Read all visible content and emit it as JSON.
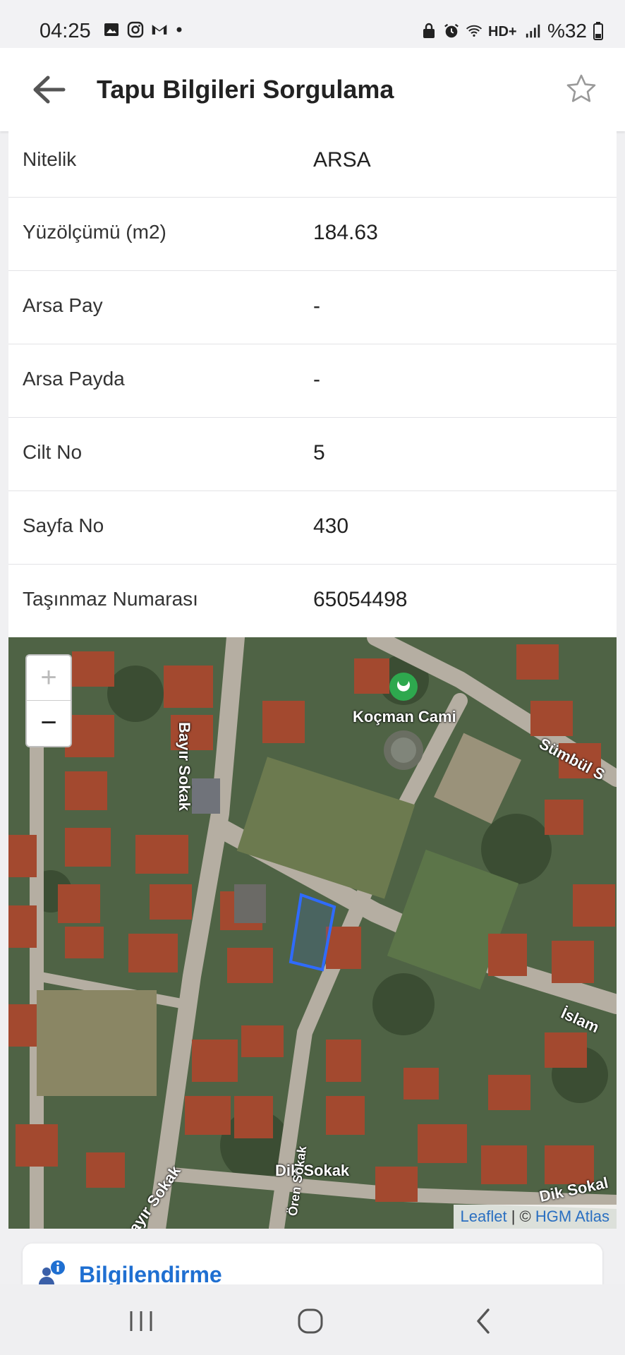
{
  "status_bar": {
    "time": "04:25",
    "left_icons": [
      "gallery-icon",
      "instagram-icon",
      "gmail-icon",
      "dot-icon"
    ],
    "right_icons": [
      "vpn-icon",
      "alarm-icon",
      "wifi-icon",
      "hd-plus-icon",
      "signal-icon"
    ],
    "battery": "%32"
  },
  "app_bar": {
    "title": "Tapu Bilgileri Sorgulama",
    "back_icon": "arrow-left-icon",
    "favorite_icon": "star-outline-icon"
  },
  "details": [
    {
      "label": "Nitelik",
      "value": "ARSA"
    },
    {
      "label": "Yüzölçümü (m2)",
      "value": "184.63"
    },
    {
      "label": "Arsa Pay",
      "value": "-"
    },
    {
      "label": "Arsa Payda",
      "value": "-"
    },
    {
      "label": "Cilt No",
      "value": "5"
    },
    {
      "label": "Sayfa No",
      "value": "430"
    },
    {
      "label": "Taşınmaz Numarası",
      "value": "65054498"
    }
  ],
  "map": {
    "zoom_in": "+",
    "zoom_out": "−",
    "labels": {
      "mosque": "Koçman Cami",
      "street1": "Bayır Sokak",
      "street2": "Sümbül S",
      "street3": "İslam",
      "street4": "Dik Sokak",
      "street5": "Bayır Sokak",
      "street6": "Ören Sokak",
      "street7": "Dik Sokal"
    },
    "attribution_leaflet": "Leaflet",
    "attribution_sep": " | © ",
    "attribution_source": "HGM Atlas",
    "parcel_color": "#2f6bff"
  },
  "info_card": {
    "title": "Bilgilendirme"
  },
  "nav_bar": {
    "recent": "recent-apps-icon",
    "home": "home-icon",
    "back": "back-icon"
  }
}
